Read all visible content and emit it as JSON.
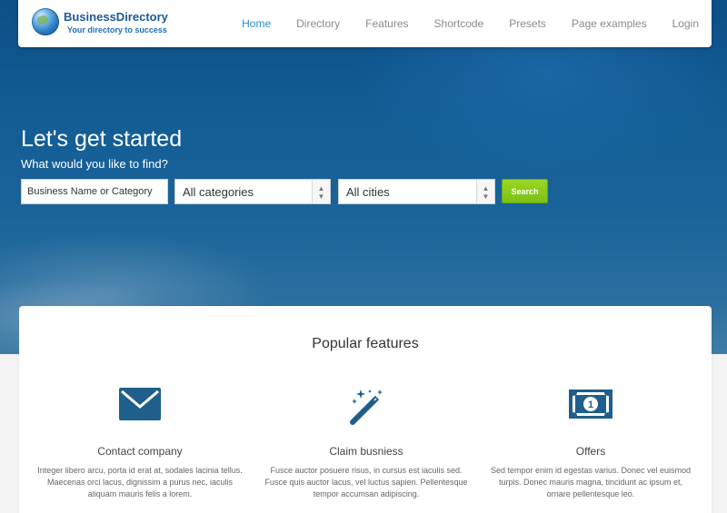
{
  "brand": {
    "name": "BusinessDirectory",
    "tagline": "Your directory to success"
  },
  "nav": {
    "items": [
      {
        "label": "Home",
        "active": true
      },
      {
        "label": "Directory",
        "active": false
      },
      {
        "label": "Features",
        "active": false
      },
      {
        "label": "Shortcode",
        "active": false
      },
      {
        "label": "Presets",
        "active": false
      },
      {
        "label": "Page examples",
        "active": false
      },
      {
        "label": "Login",
        "active": false
      }
    ]
  },
  "hero": {
    "title": "Let's get started",
    "subtitle": "What would you like to find?"
  },
  "search": {
    "placeholder": "Business Name or Category",
    "category_selected": "All categories",
    "city_selected": "All cities",
    "button_label": "Search"
  },
  "features": {
    "title": "Popular features",
    "items": [
      {
        "icon": "envelope-icon",
        "title": "Contact company",
        "description": "Integer libero arcu, porta id erat at, sodales lacinia tellus. Maecenas orci lacus, dignissim a purus nec, iaculis aliquam mauris felis a lorem."
      },
      {
        "icon": "magic-wand-icon",
        "title": "Claim busniess",
        "description": "Fusce auctor posuere risus, in cursus est iaculis sed. Fusce quis auctor lacus, vel luctus sapien. Pellentesque tempor  accumsan adipiscing."
      },
      {
        "icon": "money-bill-icon",
        "title": "Offers",
        "description": "Sed tempor enim id egestas varius. Donec vel euismod turpis. Donec mauris magna, tincidunt ac ipsum et, ornare pellentesque leo."
      }
    ]
  },
  "colors": {
    "accent": "#2a8fd0",
    "icon": "#1f5f8b",
    "search_button": "#8cc81c",
    "hero_blue": "#135d95"
  }
}
